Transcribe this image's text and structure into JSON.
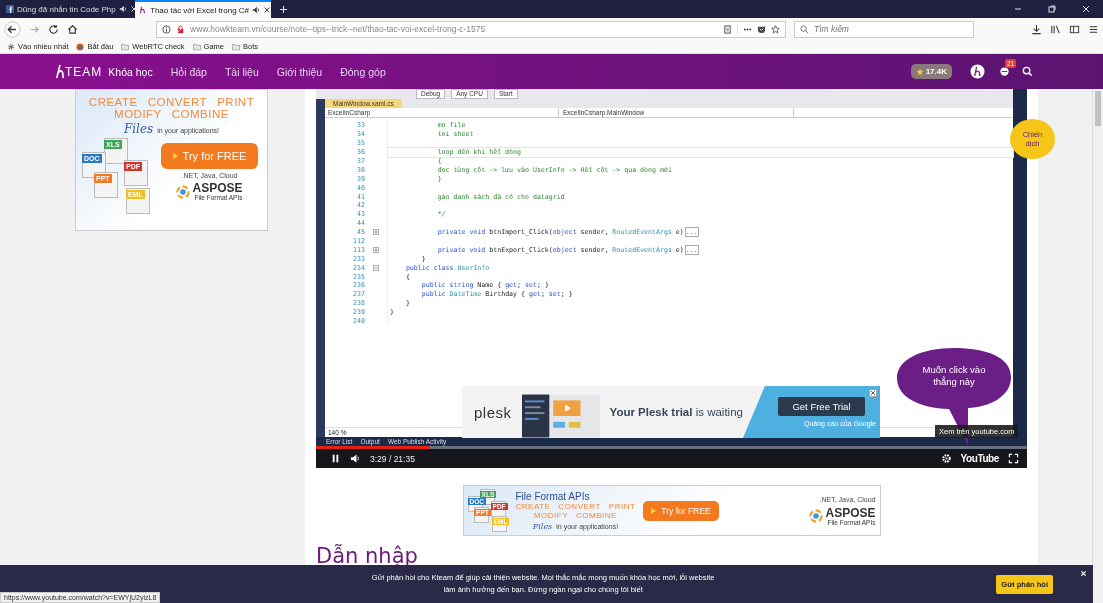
{
  "browser": {
    "tabs": [
      {
        "title": "Dũng đã nhắn tin Code Php",
        "audio": true,
        "selected": false
      },
      {
        "title": "Thao tác với Excel trong C#",
        "audio": true,
        "selected": true
      }
    ],
    "url": "www.howkteam.vn/course/note--tips--trick--net/thao-tac-voi-excel-trong-c-1575",
    "search_placeholder": "Tìm kiếm",
    "bookmarks": [
      {
        "label": "Vào nhiều nhất"
      },
      {
        "label": "Bắt đầu"
      },
      {
        "label": "WebRTC check"
      },
      {
        "label": "Game"
      },
      {
        "label": "Bots"
      }
    ]
  },
  "site_header": {
    "logo": "TEAM",
    "nav": [
      {
        "label": "Khóa học",
        "selected": true
      },
      {
        "label": "Hỏi đáp",
        "selected": false
      },
      {
        "label": "Tài liệu",
        "selected": false
      },
      {
        "label": "Giới thiệu",
        "selected": false
      },
      {
        "label": "Đóng góp",
        "selected": false
      }
    ],
    "stars": "17.4K",
    "notifications": "21"
  },
  "side_ad": {
    "verb_rows": [
      [
        "CREATE",
        "CONVERT",
        "PRINT"
      ],
      [
        "MODIFY",
        "COMBINE"
      ]
    ],
    "files_word": "Files",
    "tagline": "in your applications!",
    "cta": "Try for FREE",
    "platforms": ".NET, Java, Cloud",
    "brand": "ASPOSE",
    "brand_sub": "File Format APIs",
    "file_tags": [
      {
        "label": "XLS",
        "color": "#3aa656"
      },
      {
        "label": "DOC",
        "color": "#2b78c5"
      },
      {
        "label": "PDF",
        "color": "#d9322b"
      },
      {
        "label": "PPT",
        "color": "#ee7a2a"
      },
      {
        "label": "EML",
        "color": "#f0c020"
      }
    ]
  },
  "video": {
    "ide": {
      "toolbar": [
        "Debug",
        "Any CPU",
        "Start"
      ],
      "file_tab": "MainWindow.xaml.cs",
      "dropdowns": [
        "ExcelInCsharp",
        "ExcelInCsharp.MainWindow"
      ],
      "code_lines": [
        {
          "number": "33",
          "current": false,
          "tokens": [
            {
              "kind": "comment",
              "text": "            mo file"
            }
          ]
        },
        {
          "number": "34",
          "current": false,
          "tokens": [
            {
              "kind": "comment",
              "text": "            toi sheet"
            }
          ]
        },
        {
          "number": "35",
          "current": false
        },
        {
          "number": "36",
          "current": true,
          "tokens": [
            {
              "kind": "comment",
              "text": "            loop đến khi hết dòng"
            }
          ]
        },
        {
          "number": "37",
          "current": false,
          "tokens": [
            {
              "kind": "comment",
              "text": "            {"
            }
          ]
        },
        {
          "number": "38",
          "current": false,
          "tokens": [
            {
              "kind": "comment",
              "text": "            đọc từng cột -> lưu vào UserInfo -> Hết cột -> qua dòng mới"
            }
          ]
        },
        {
          "number": "39",
          "current": false,
          "tokens": [
            {
              "kind": "comment",
              "text": "            }"
            }
          ]
        },
        {
          "number": "40",
          "current": false
        },
        {
          "number": "41",
          "current": false,
          "tokens": [
            {
              "kind": "comment",
              "text": "            gán danh sách đã có cho datagrid"
            }
          ]
        },
        {
          "number": "42",
          "current": false
        },
        {
          "number": "43",
          "current": false,
          "tokens": [
            {
              "kind": "comment",
              "text": "            */"
            }
          ]
        },
        {
          "number": "44",
          "current": false
        },
        {
          "number": "45",
          "current": false,
          "kind": "collapsed",
          "collapsed_text": "...",
          "tokens": [
            {
              "kind": "keyword",
              "text": "            private void"
            },
            {
              "kind": "plain",
              "text": " btnImport_Click("
            },
            {
              "kind": "keyword",
              "text": "object"
            },
            {
              "kind": "plain",
              "text": " sender, "
            },
            {
              "kind": "type",
              "text": "RoutedEventArgs"
            },
            {
              "kind": "plain",
              "text": " e)"
            }
          ]
        },
        {
          "number": "112",
          "current": false
        },
        {
          "number": "113",
          "current": false,
          "kind": "collapsed",
          "collapsed_text": "...",
          "tokens": [
            {
              "kind": "keyword",
              "text": "            private void"
            },
            {
              "kind": "plain",
              "text": " btnExport_Click("
            },
            {
              "kind": "keyword",
              "text": "object"
            },
            {
              "kind": "plain",
              "text": " sender, "
            },
            {
              "kind": "type",
              "text": "RoutedEventArgs"
            },
            {
              "kind": "plain",
              "text": " e)"
            }
          ]
        },
        {
          "number": "233",
          "current": false,
          "tokens": [
            {
              "kind": "plain",
              "text": "        }"
            }
          ]
        },
        {
          "number": "234",
          "current": false,
          "kind": "expanded",
          "tokens": [
            {
              "kind": "keyword",
              "text": "    public class"
            },
            {
              "kind": "type",
              "text": " UserInfo"
            }
          ]
        },
        {
          "number": "235",
          "current": false,
          "tokens": [
            {
              "kind": "plain",
              "text": "    {"
            }
          ]
        },
        {
          "number": "236",
          "current": false,
          "tokens": [
            {
              "kind": "keyword",
              "text": "        public string"
            },
            {
              "kind": "plain",
              "text": " Name { "
            },
            {
              "kind": "keyword",
              "text": "get"
            },
            {
              "kind": "plain",
              "text": "; "
            },
            {
              "kind": "keyword",
              "text": "set"
            },
            {
              "kind": "plain",
              "text": "; }"
            }
          ]
        },
        {
          "number": "237",
          "current": false,
          "tokens": [
            {
              "kind": "keyword",
              "text": "        public"
            },
            {
              "kind": "type",
              "text": " DateTime"
            },
            {
              "kind": "plain",
              "text": " Birthday { "
            },
            {
              "kind": "keyword",
              "text": "get"
            },
            {
              "kind": "plain",
              "text": "; "
            },
            {
              "kind": "keyword",
              "text": "set"
            },
            {
              "kind": "plain",
              "text": "; }"
            }
          ]
        },
        {
          "number": "238",
          "current": false,
          "tokens": [
            {
              "kind": "plain",
              "text": "    }"
            }
          ]
        },
        {
          "number": "239",
          "current": false,
          "tokens": [
            {
              "kind": "plain",
              "text": "}"
            }
          ]
        },
        {
          "number": "240",
          "current": false
        }
      ],
      "zoom": "140 %",
      "panel_tabs": [
        "Error List",
        "Output",
        "Web Publish Activity"
      ]
    },
    "ad": {
      "brand": "plesk",
      "headline": "**Your Plesk trial** is waiting",
      "button": "Get Free Trial",
      "attribution": "Quảng cáo của Google"
    },
    "tooltip": "Xem trên youtube.com",
    "callout": "Muốn click vào thẳng này",
    "controls": {
      "playing": true,
      "time": "3:29 / 21:35",
      "level": 0.16,
      "logo": "YouTube"
    }
  },
  "bottom_ad": {
    "title": "File Format APIs",
    "verb_rows": [
      [
        "CREATE",
        "CONVERT",
        "PRINT"
      ],
      [
        "MODIFY",
        "COMBINE"
      ]
    ],
    "files_word": "Files",
    "tagline": "in your applications!",
    "cta": "Try for FREE",
    "platforms": ".NET, Java, Cloud",
    "brand": "ASPOSE",
    "brand_sub": "File Format APIs",
    "file_tags": [
      {
        "label": "XLS",
        "color": "#3aa656"
      },
      {
        "label": "DOC",
        "color": "#2b78c5"
      },
      {
        "label": "PDF",
        "color": "#d9322b"
      },
      {
        "label": "PPT",
        "color": "#ee7a2a"
      },
      {
        "label": "EML",
        "color": "#f0c020"
      }
    ]
  },
  "heading": "Dẫn nhập",
  "campaign_button": "Chiến dịch",
  "feedback_bar": {
    "message_lines": [
      "Gửi phản hồi cho Kteam để giúp cải thiện website. Mọi thắc mắc mong muốn khóa học mới, lỗi website",
      "làm ảnh hưởng đến bạn. Đừng ngần ngại cho chúng tôi biết"
    ],
    "button": "Gửi phản hồi"
  },
  "status_url": "https://www.youtube.com/watch?v=EWYjU2yizL8"
}
